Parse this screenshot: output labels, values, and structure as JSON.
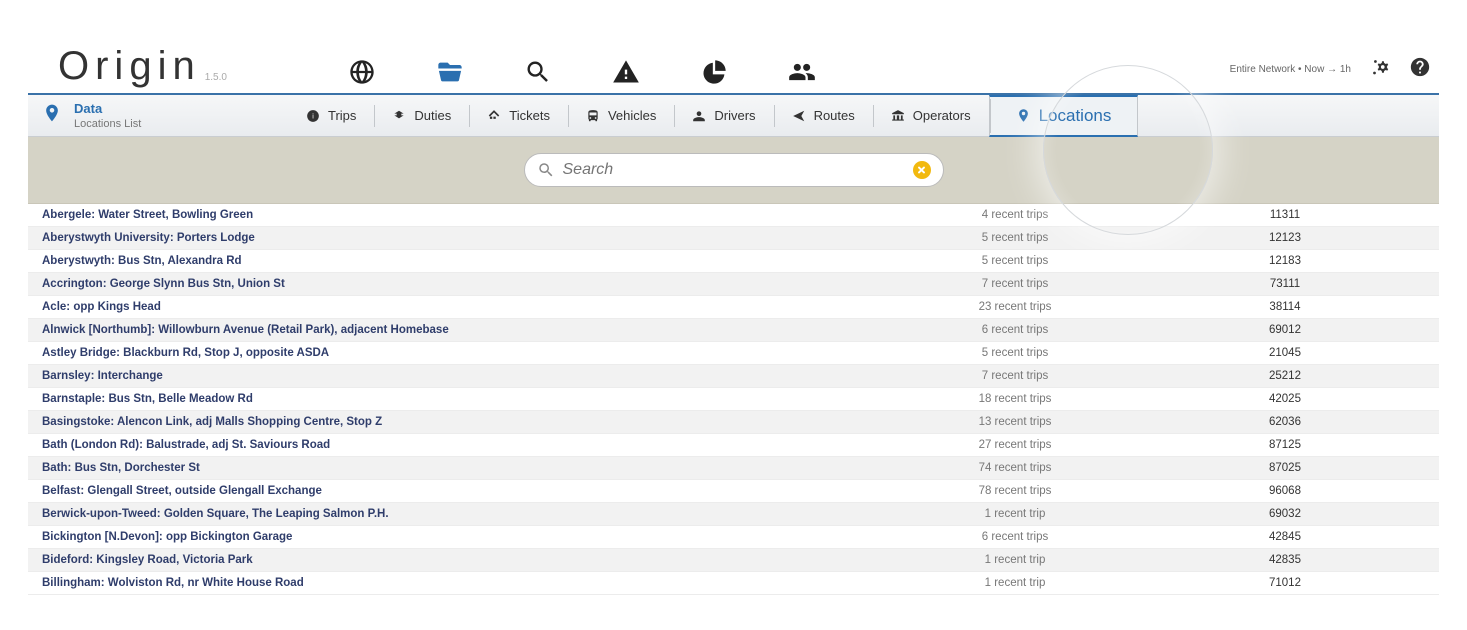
{
  "app": {
    "name": "Origin",
    "version": "1.5.0"
  },
  "header": {
    "network_text": "Entire Network • Now → 1h"
  },
  "subnav": {
    "category": "Data",
    "page": "Locations List",
    "tabs": [
      {
        "id": "trips",
        "label": "Trips",
        "icon": "info"
      },
      {
        "id": "duties",
        "label": "Duties",
        "icon": "sitemap"
      },
      {
        "id": "tickets",
        "label": "Tickets",
        "icon": "tag"
      },
      {
        "id": "vehicles",
        "label": "Vehicles",
        "icon": "bus"
      },
      {
        "id": "drivers",
        "label": "Drivers",
        "icon": "user"
      },
      {
        "id": "routes",
        "label": "Routes",
        "icon": "arrow"
      },
      {
        "id": "operators",
        "label": "Operators",
        "icon": "bank"
      },
      {
        "id": "locations",
        "label": "Locations",
        "icon": "pin",
        "active": true
      }
    ]
  },
  "search": {
    "placeholder": "Search"
  },
  "locations": [
    {
      "name": "Abergele: Water Street, Bowling Green",
      "trips": "4 recent trips",
      "code": "11311"
    },
    {
      "name": "Aberystwyth University: Porters Lodge",
      "trips": "5 recent trips",
      "code": "12123"
    },
    {
      "name": "Aberystwyth: Bus Stn, Alexandra Rd",
      "trips": "5 recent trips",
      "code": "12183"
    },
    {
      "name": "Accrington: George Slynn Bus Stn, Union St",
      "trips": "7 recent trips",
      "code": "73111"
    },
    {
      "name": "Acle: opp Kings Head",
      "trips": "23 recent trips",
      "code": "38114"
    },
    {
      "name": "Alnwick [Northumb]: Willowburn Avenue (Retail Park), adjacent Homebase",
      "trips": "6 recent trips",
      "code": "69012"
    },
    {
      "name": "Astley Bridge: Blackburn Rd, Stop J, opposite ASDA",
      "trips": "5 recent trips",
      "code": "21045"
    },
    {
      "name": "Barnsley: Interchange",
      "trips": "7 recent trips",
      "code": "25212"
    },
    {
      "name": "Barnstaple: Bus Stn, Belle Meadow Rd",
      "trips": "18 recent trips",
      "code": "42025"
    },
    {
      "name": "Basingstoke: Alencon Link, adj Malls Shopping Centre, Stop Z",
      "trips": "13 recent trips",
      "code": "62036"
    },
    {
      "name": "Bath (London Rd): Balustrade, adj St. Saviours Road",
      "trips": "27 recent trips",
      "code": "87125"
    },
    {
      "name": "Bath: Bus Stn, Dorchester St",
      "trips": "74 recent trips",
      "code": "87025"
    },
    {
      "name": "Belfast: Glengall Street, outside Glengall Exchange",
      "trips": "78 recent trips",
      "code": "96068"
    },
    {
      "name": "Berwick-upon-Tweed: Golden Square, The Leaping Salmon P.H.",
      "trips": "1 recent trip",
      "code": "69032"
    },
    {
      "name": "Bickington [N.Devon]: opp Bickington Garage",
      "trips": "6 recent trips",
      "code": "42845"
    },
    {
      "name": "Bideford: Kingsley Road, Victoria Park",
      "trips": "1 recent trip",
      "code": "42835"
    },
    {
      "name": "Billingham: Wolviston Rd, nr White House Road",
      "trips": "1 recent trip",
      "code": "71012"
    }
  ]
}
